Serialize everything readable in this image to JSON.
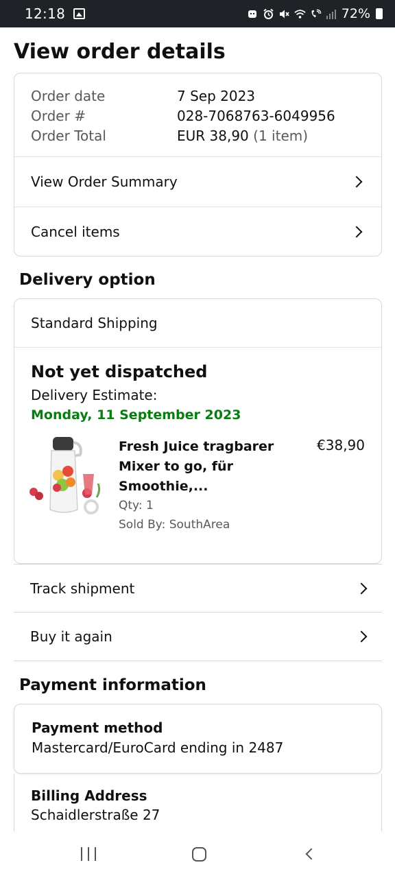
{
  "status_bar": {
    "time": "12:18",
    "battery": "72%",
    "icons": [
      "gallery-icon",
      "android-icon",
      "alarm-icon",
      "mute-icon",
      "wifi-icon",
      "wifi-calling-icon",
      "signal-icon",
      "battery-icon"
    ]
  },
  "page": {
    "title": "View order details"
  },
  "order": {
    "date_label": "Order date",
    "date_value": "7 Sep 2023",
    "number_label": "Order #",
    "number_value": "028-7068763-6049956",
    "total_label": "Order Total",
    "total_value": "EUR 38,90",
    "total_items": "(1 item)",
    "links": {
      "summary": "View Order Summary",
      "cancel": "Cancel items"
    }
  },
  "delivery": {
    "section_title": "Delivery option",
    "method": "Standard Shipping",
    "status": "Not yet dispatched",
    "estimate_label": "Delivery Estimate:",
    "estimate_date": "Monday, 11 September 2023",
    "estimate_color": "#067d0f",
    "product": {
      "title": "Fresh Juice tragbarer Mixer to go, für Smoothie,...",
      "price": "€38,90",
      "qty": "Qty: 1",
      "seller": "Sold By: SouthArea"
    }
  },
  "actions": {
    "track": "Track shipment",
    "buy_again": "Buy it again"
  },
  "payment": {
    "section_title": "Payment information",
    "method_title": "Payment method",
    "method_value": "Mastercard/EuroCard  ending in 2487",
    "billing_title": "Billing Address",
    "billing_line1": "Schaidlerstraße 27"
  }
}
